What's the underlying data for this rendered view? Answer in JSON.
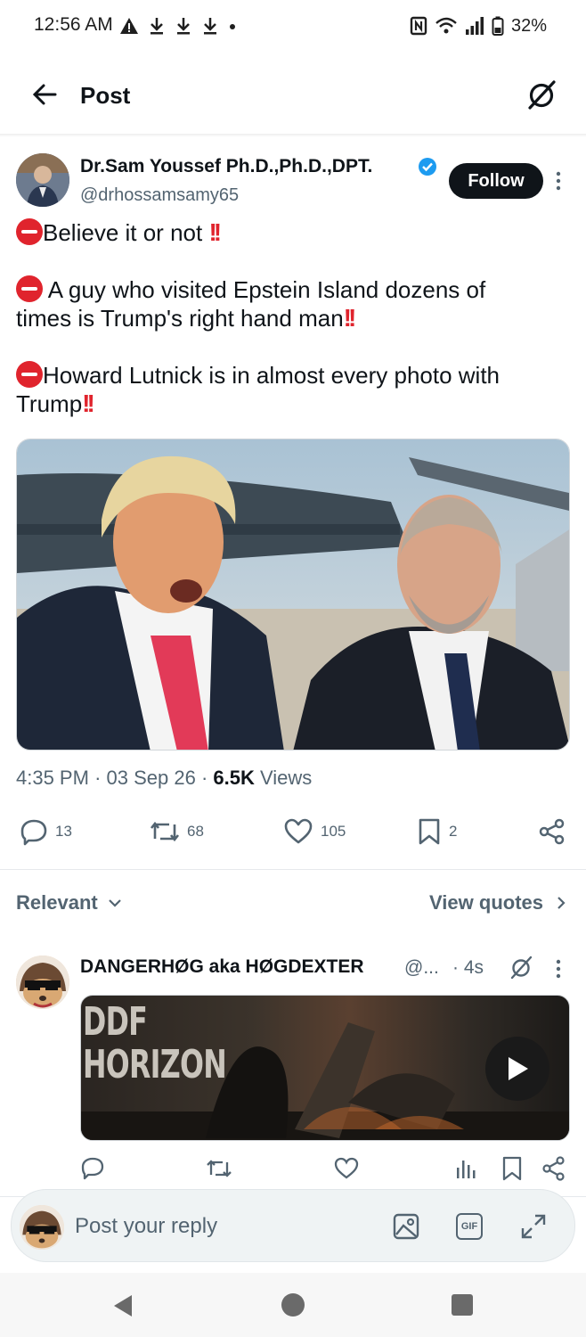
{
  "status_bar": {
    "time": "12:56 AM",
    "battery": "32%"
  },
  "header": {
    "title": "Post"
  },
  "tweet": {
    "author_name": "Dr.Sam Youssef Ph.D.,Ph.D.,DPT.",
    "handle": "@drhossamsamy65",
    "follow_label": "Follow",
    "lines": [
      "Believe it or not",
      "A guy who visited Epstein Island dozens of",
      "times is Trump's right hand man",
      "Howard Lutnick is in almost every photo with",
      "Trump"
    ],
    "time": "4:35 PM",
    "date": "03 Sep 26",
    "views_count": "6.5K",
    "views_label": "Views",
    "counts": {
      "replies": "13",
      "reposts": "68",
      "likes": "105",
      "bookmarks": "2"
    }
  },
  "replies_section": {
    "sort_label": "Relevant",
    "view_quotes_label": "View quotes"
  },
  "reply": {
    "name": "DANGERHØG aka HØGDEXTER",
    "handle": "@...",
    "time": "· 4s",
    "video_title": "DDF\nHORIZON"
  },
  "composer": {
    "placeholder": "Post your reply",
    "gif_label": "GIF"
  },
  "colors": {
    "text": "#0f1419",
    "secondary": "#536471",
    "verified": "#1d9bf0",
    "emoji_red": "#e0242d"
  }
}
